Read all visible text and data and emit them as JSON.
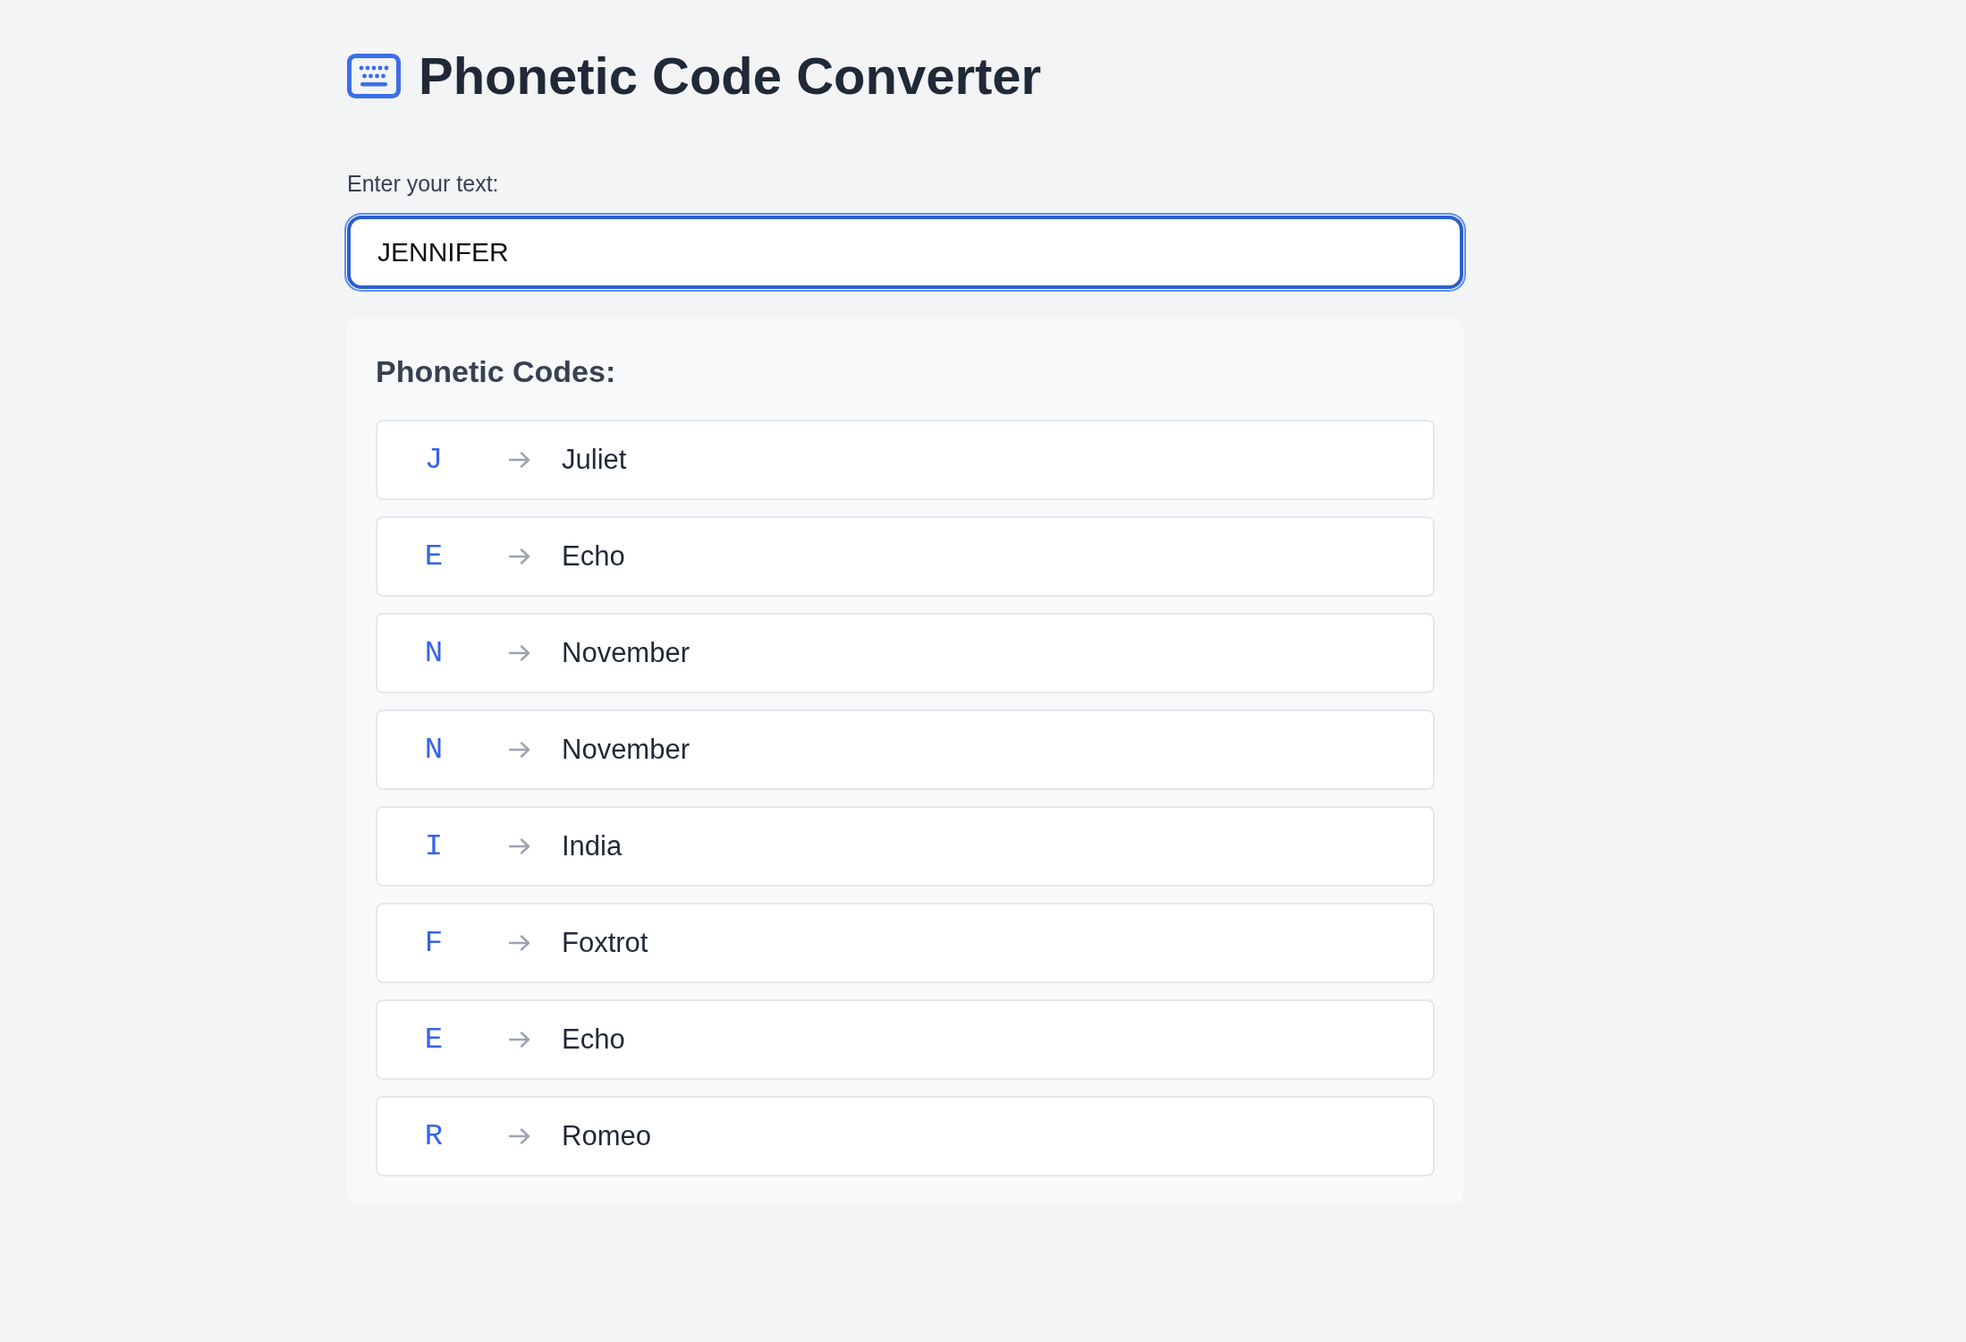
{
  "header": {
    "title": "Phonetic Code Converter"
  },
  "input": {
    "label": "Enter your text:",
    "value": "JENNIFER",
    "focused": true
  },
  "results": {
    "heading": "Phonetic Codes:",
    "rows": [
      {
        "letter": "J",
        "word": "Juliet"
      },
      {
        "letter": "E",
        "word": "Echo"
      },
      {
        "letter": "N",
        "word": "November"
      },
      {
        "letter": "N",
        "word": "November"
      },
      {
        "letter": "I",
        "word": "India"
      },
      {
        "letter": "F",
        "word": "Foxtrot"
      },
      {
        "letter": "E",
        "word": "Echo"
      },
      {
        "letter": "R",
        "word": "Romeo"
      }
    ]
  }
}
